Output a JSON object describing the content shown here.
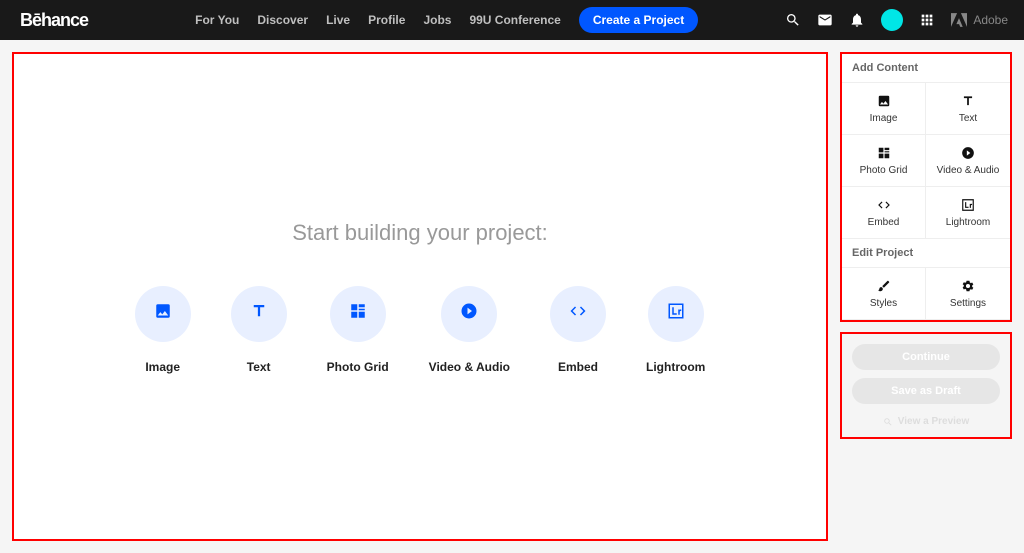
{
  "header": {
    "logo": "Bēhance",
    "nav": [
      "For You",
      "Discover",
      "Live",
      "Profile",
      "Jobs",
      "99U Conference"
    ],
    "create_label": "Create a Project",
    "adobe_label": "Adobe"
  },
  "canvas": {
    "title": "Start building your project:",
    "tools": [
      "Image",
      "Text",
      "Photo Grid",
      "Video & Audio",
      "Embed",
      "Lightroom"
    ]
  },
  "sidebar": {
    "add_header": "Add Content",
    "add_items": [
      "Image",
      "Text",
      "Photo Grid",
      "Video & Audio",
      "Embed",
      "Lightroom"
    ],
    "edit_header": "Edit Project",
    "edit_items": [
      "Styles",
      "Settings"
    ]
  },
  "actions": {
    "continue": "Continue",
    "draft": "Save as Draft",
    "preview": "View a Preview"
  }
}
